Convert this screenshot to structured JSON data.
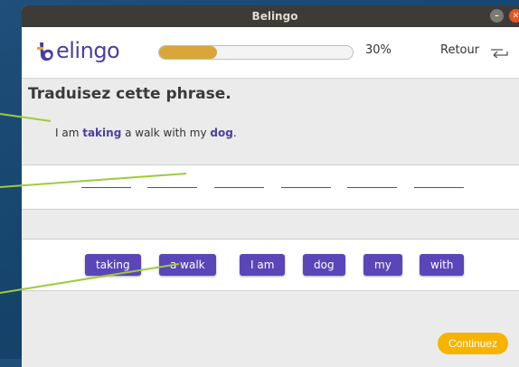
{
  "window": {
    "title": "Belingo"
  },
  "header": {
    "logo_text": "elingo",
    "progress_percent": 30,
    "progress_label": "30%",
    "back_label": "Retour"
  },
  "exercise": {
    "instruction": "Traduisez cette phrase.",
    "sentence": {
      "p1": "I am ",
      "k1": "taking",
      "p2": " a walk with my ",
      "k2": "dog",
      "p3": "."
    },
    "slot_count": 6
  },
  "word_bank": [
    "taking",
    "a walk",
    "I am",
    "dog",
    "my",
    "with"
  ],
  "actions": {
    "continue_label": "Continuez"
  },
  "colors": {
    "accent": "#5a46b8",
    "progress": "#d9a63a",
    "continue": "#f6b400"
  }
}
